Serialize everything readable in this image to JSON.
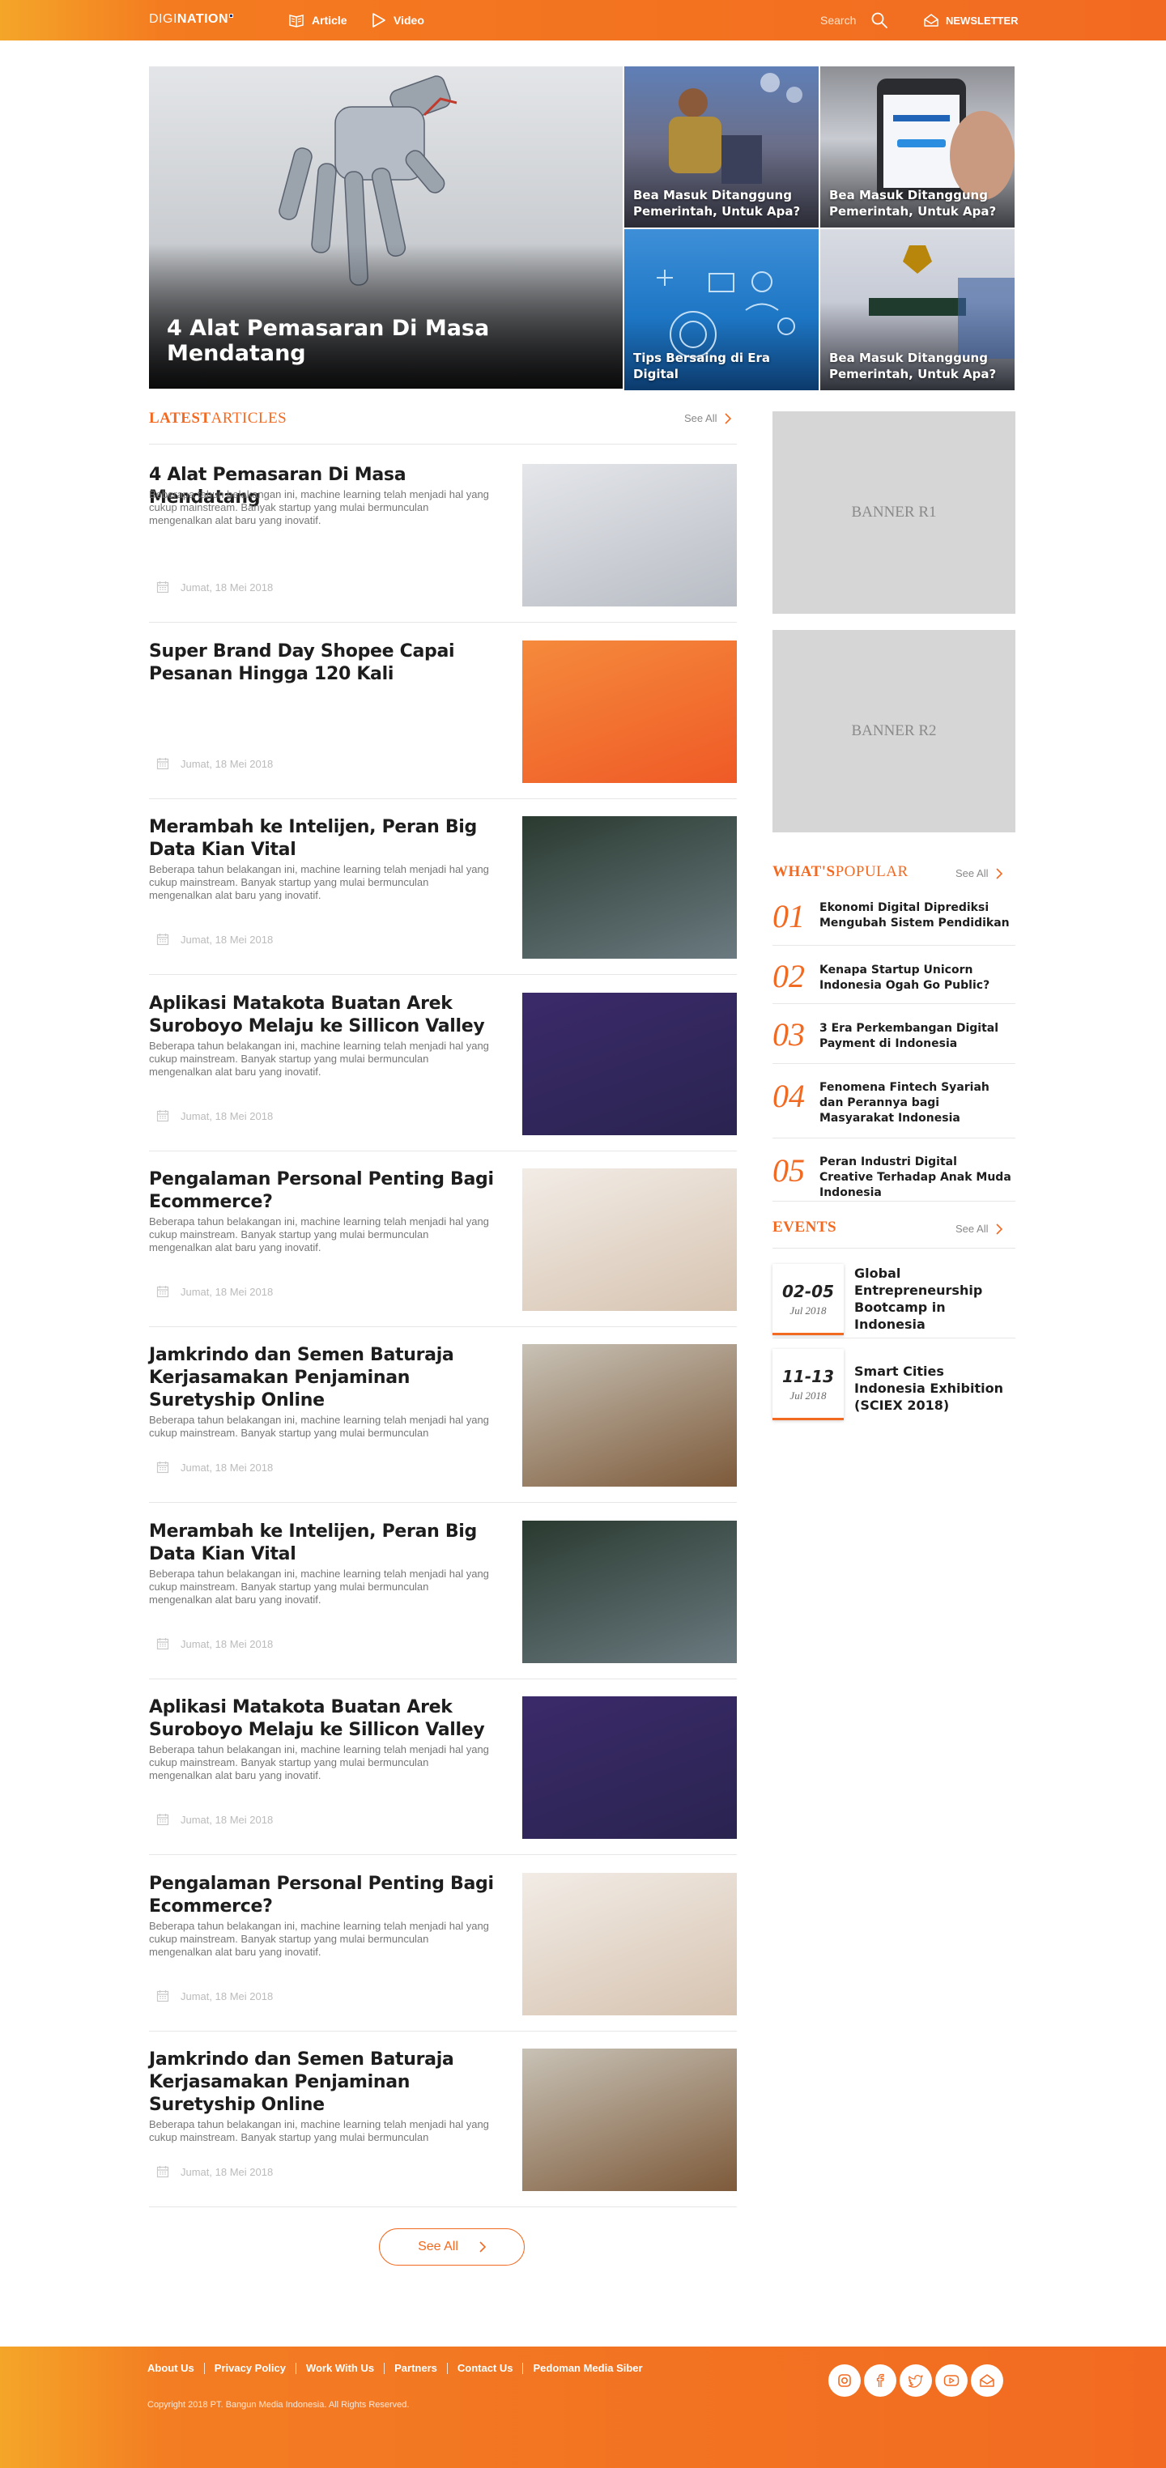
{
  "header": {
    "logo_light": "DIGI",
    "logo_bold": "NATION",
    "nav": {
      "article": "Article",
      "video": "Video"
    },
    "search_placeholder": "Search",
    "newsletter": "NEWSLETTER"
  },
  "hero": {
    "main_title": "4 Alat Pemasaran Di Masa Mendatang",
    "tiles": [
      "Bea Masuk Ditanggung Pemerintah, Untuk Apa?",
      "Bea Masuk Ditanggung Pemerintah, Untuk Apa?",
      "Tips Bersaing di Era Digital",
      "Bea Masuk Ditanggung Pemerintah, Untuk Apa?"
    ]
  },
  "latest": {
    "heading_bold": "LATEST",
    "heading_light": "ARTICLES",
    "see_all": "See All",
    "see_all_button": "See All",
    "articles": [
      {
        "title": "4 Alat Pemasaran Di Masa Mendatang",
        "excerpt": "Beberapa tahun belakangan ini, machine learning telah menjadi hal yang cukup mainstream. Banyak startup yang mulai bermunculan mengenalkan alat baru yang inovatif.",
        "date": "Jumat, 18 Mei 2018"
      },
      {
        "title": "Super Brand Day Shopee Capai Pesanan Hingga 120 Kali",
        "excerpt": "",
        "date": "Jumat, 18 Mei 2018"
      },
      {
        "title": "Merambah ke Intelijen, Peran Big Data Kian Vital",
        "excerpt": "Beberapa tahun belakangan ini, machine learning telah menjadi hal yang cukup mainstream. Banyak startup yang mulai bermunculan mengenalkan alat baru yang inovatif.",
        "date": "Jumat, 18 Mei 2018"
      },
      {
        "title": "Aplikasi Matakota Buatan Arek Suroboyo Melaju ke Sillicon Valley",
        "excerpt": "Beberapa tahun belakangan ini, machine learning telah menjadi hal yang cukup mainstream. Banyak startup yang mulai bermunculan mengenalkan alat baru yang inovatif.",
        "date": "Jumat, 18 Mei 2018"
      },
      {
        "title": "Pengalaman Personal Penting Bagi Ecommerce?",
        "excerpt": "Beberapa tahun belakangan ini, machine learning telah menjadi hal yang cukup mainstream. Banyak startup yang mulai bermunculan mengenalkan alat baru yang inovatif.",
        "date": "Jumat, 18 Mei 2018"
      },
      {
        "title": "Jamkrindo dan Semen Baturaja Kerjasamakan Penjaminan Suretyship Online",
        "excerpt": "Beberapa tahun belakangan ini, machine learning telah menjadi hal yang cukup mainstream. Banyak startup yang mulai bermunculan",
        "date": "Jumat, 18 Mei 2018"
      },
      {
        "title": "Merambah ke Intelijen, Peran Big Data Kian Vital",
        "excerpt": "Beberapa tahun belakangan ini, machine learning telah menjadi hal yang cukup mainstream. Banyak startup yang mulai bermunculan mengenalkan alat baru yang inovatif.",
        "date": "Jumat, 18 Mei 2018"
      },
      {
        "title": "Aplikasi Matakota Buatan Arek Suroboyo Melaju ke Sillicon Valley",
        "excerpt": "Beberapa tahun belakangan ini, machine learning telah menjadi hal yang cukup mainstream. Banyak startup yang mulai bermunculan mengenalkan alat baru yang inovatif.",
        "date": "Jumat, 18 Mei 2018"
      },
      {
        "title": "Pengalaman Personal Penting Bagi Ecommerce?",
        "excerpt": "Beberapa tahun belakangan ini, machine learning telah menjadi hal yang cukup mainstream. Banyak startup yang mulai bermunculan mengenalkan alat baru yang inovatif.",
        "date": "Jumat, 18 Mei 2018"
      },
      {
        "title": "Jamkrindo dan Semen Baturaja Kerjasamakan Penjaminan Suretyship Online",
        "excerpt": "Beberapa tahun belakangan ini, machine learning telah menjadi hal yang cukup mainstream. Banyak startup yang mulai bermunculan",
        "date": "Jumat, 18 Mei 2018"
      }
    ]
  },
  "sidebar": {
    "banners": [
      "BANNER R1",
      "BANNER R2"
    ],
    "popular": {
      "heading_bold": "WHAT'S",
      "heading_light": "POPULAR",
      "see_all": "See All",
      "items": [
        {
          "num": "01",
          "title": "Ekonomi Digital Diprediksi Mengubah Sistem Pendidikan"
        },
        {
          "num": "02",
          "title": "Kenapa Startup Unicorn Indonesia Ogah Go Public?"
        },
        {
          "num": "03",
          "title": "3 Era Perkembangan Digital Payment di Indonesia"
        },
        {
          "num": "04",
          "title": "Fenomena Fintech Syariah dan Perannya bagi Masyarakat Indonesia"
        },
        {
          "num": "05",
          "title": "Peran Industri Digital Creative Terhadap Anak Muda Indonesia"
        }
      ]
    },
    "events": {
      "heading": "EVENTS",
      "see_all": "See All",
      "items": [
        {
          "range": "02-05",
          "month": "Jul 2018",
          "title": "Global Entrepreneurship Bootcamp in Indonesia"
        },
        {
          "range": "11-13",
          "month": "Jul 2018",
          "title": "Smart Cities Indonesia Exhibition (SCIEX 2018)"
        }
      ]
    }
  },
  "footer": {
    "links": [
      "About Us",
      "Privacy Policy",
      "Work With Us",
      "Partners",
      "Contact Us",
      "Pedoman Media Siber"
    ],
    "copyright": "Copyright 2018 PT. Bangun Media Indonesia. All Rights Reserved."
  },
  "colors": {
    "brand_orange": "#f26a21",
    "gradient_start": "#f4a629"
  }
}
